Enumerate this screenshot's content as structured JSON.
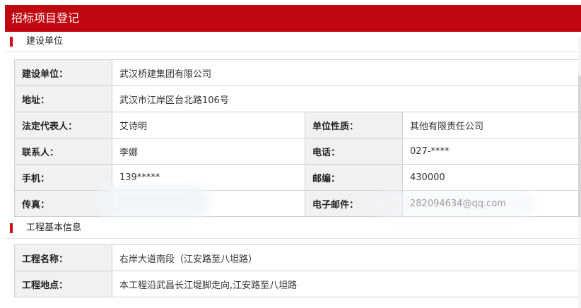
{
  "page": {
    "title": "招标项目登记"
  },
  "sections": {
    "unit": {
      "title": "建设单位"
    },
    "project": {
      "title": "工程基本信息"
    }
  },
  "unit": {
    "name_label": "建设单位：",
    "name": "武汉桥建集团有限公司",
    "address_label": "地址：",
    "address": "武汉市江岸区台北路106号",
    "legal_rep_label": "法定代表人：",
    "legal_rep": "艾诗明",
    "unit_type_label": "单位性质：",
    "unit_type": "其他有限责任公司",
    "contact_label": "联系人：",
    "contact": "李娜",
    "phone_label": "电话：",
    "phone": "027-****",
    "mobile_label": "手机：",
    "mobile": "139*****",
    "postcode_label": "邮编：",
    "postcode": "430000",
    "fax_label": "传真：",
    "fax": "",
    "email_label": "电子邮件：",
    "email": "282094634@qq.com"
  },
  "project": {
    "name_label": "工程名称：",
    "name": "右岸大道南段（江安路至八坦路）",
    "location_label": "工程地点：",
    "location": "本工程沿武昌长江堤脚走向,江安路至八坦路"
  }
}
